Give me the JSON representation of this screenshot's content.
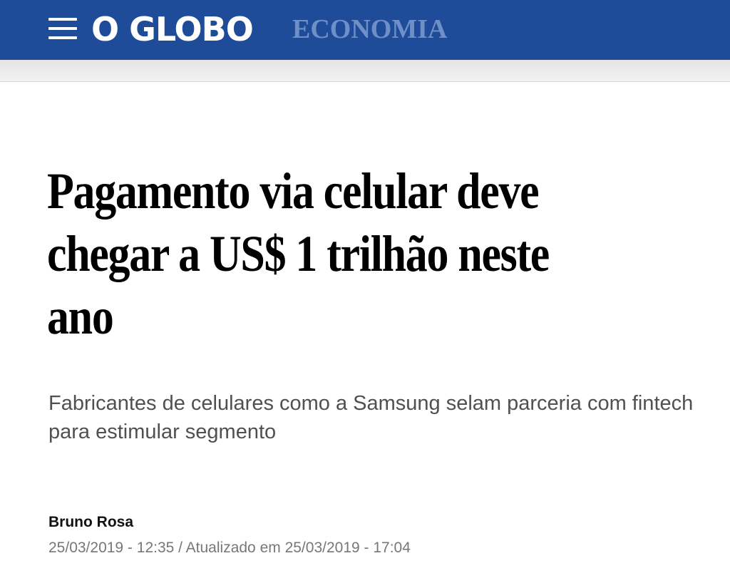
{
  "header": {
    "logo_text": "O GLOBO",
    "section_label": "ECONOMIA",
    "menu_icon": "hamburger-menu-icon",
    "background_color": "#1f4c98",
    "section_color": "#6f8fc9"
  },
  "article": {
    "headline": "Pagamento via celular deve chegar a US$ 1 trilhão neste ano",
    "subtitle": "Fabricantes de celulares como a Samsung selam parceria com fintech para estimular segmento",
    "author": "Bruno Rosa",
    "dates": "25/03/2019 - 12:35 / Atualizado em 25/03/2019 - 17:04"
  }
}
